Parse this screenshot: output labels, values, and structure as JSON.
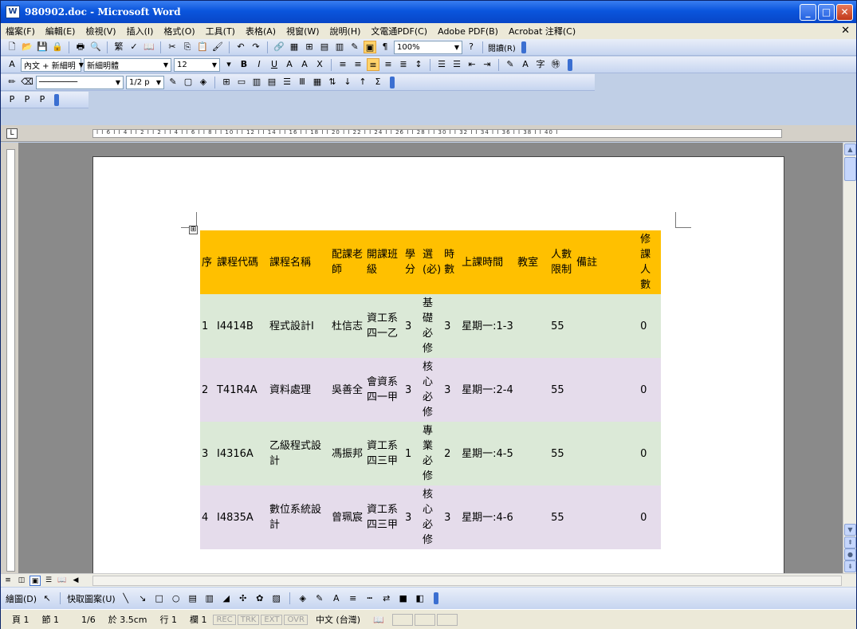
{
  "window": {
    "title": "980902.doc - Microsoft Word",
    "app_icon": "word-doc-icon"
  },
  "menu": [
    "檔案(F)",
    "編輯(E)",
    "檢視(V)",
    "插入(I)",
    "格式(O)",
    "工具(T)",
    "表格(A)",
    "視窗(W)",
    "說明(H)",
    "文電通PDF(C)",
    "Adobe PDF(B)",
    "Acrobat 注釋(C)"
  ],
  "toolbar": {
    "traditional_label": "繁",
    "zoom": "100%",
    "reading_label": "閱讀(R)",
    "style": "內文 + 新細明",
    "font": "新細明體",
    "size": "12",
    "line_weight": "1/2 p"
  },
  "ruler": {
    "ticks": "I  I 6 I  I 4 I  I 2 I    I 2 I  I 4 I  I 6 I  I 8 I  I 10 I  I 12 I  I 14 I  I 16 I  I 18 I  I 20 I  I 22 I  I 24 I  I 26 I  I 28 I  I 30 I  I 32 I  I 34 I  I 36 I  I 38 I  I 40 I"
  },
  "table": {
    "headers": [
      "序",
      "課程代碼",
      "課程名稱",
      "配課老師",
      "開課班級",
      "學分",
      "選(必)",
      "時數",
      "上課時間",
      "教室",
      "人數限制",
      "備註",
      "修課人數"
    ],
    "rows": [
      {
        "no": "1",
        "code": "I4414B",
        "name": "程式設計Ⅰ",
        "teacher": "杜信志",
        "class": "資工系四一乙",
        "credit": "3",
        "type": "基礎必修",
        "hours": "3",
        "time": "星期一:1-3",
        "room": "",
        "limit": "55",
        "note": "",
        "enrolled": "0"
      },
      {
        "no": "2",
        "code": "T41R4A",
        "name": "資料處理",
        "teacher": "吳善全",
        "class": "會資系四一甲",
        "credit": "3",
        "type": "核心必修",
        "hours": "3",
        "time": "星期一:2-4",
        "room": "",
        "limit": "55",
        "note": "",
        "enrolled": "0"
      },
      {
        "no": "3",
        "code": "I4316A",
        "name": "乙級程式設計",
        "teacher": "馮振邦",
        "class": "資工系四三甲",
        "credit": "1",
        "type": "專業必修",
        "hours": "2",
        "time": "星期一:4-5",
        "room": "",
        "limit": "55",
        "note": "",
        "enrolled": "0"
      },
      {
        "no": "4",
        "code": "I4835A",
        "name": "數位系統設計",
        "teacher": "曾珮宸",
        "class": "資工系四三甲",
        "credit": "3",
        "type": "核心必修",
        "hours": "3",
        "time": "星期一:4-6",
        "room": "",
        "limit": "55",
        "note": "",
        "enrolled": "0"
      }
    ]
  },
  "drawing": {
    "draw_label": "繪圖(D)",
    "autoshape_label": "快取圖案(U)"
  },
  "status": {
    "page": "頁 1",
    "section": "節 1",
    "page_of": "1/6",
    "at": "於 3.5cm",
    "line": "行 1",
    "col": "欄 1",
    "modes": [
      "REC",
      "TRK",
      "EXT",
      "OVR"
    ],
    "language": "中文 (台灣)"
  },
  "colors": {
    "header": "#ffc000",
    "row_green": "#dbe9d7",
    "row_purple": "#e5dceb"
  }
}
